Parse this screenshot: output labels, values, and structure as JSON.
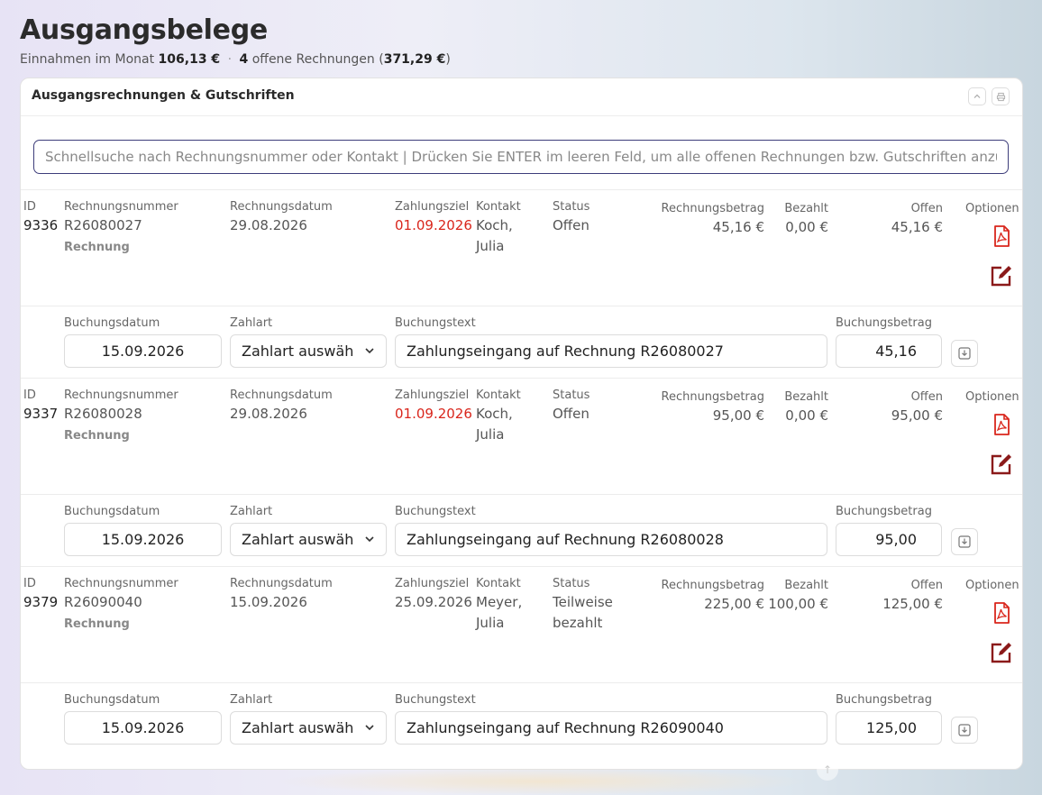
{
  "page": {
    "title": "Ausgangsbelege",
    "summary": {
      "income_label": "Einnahmen im Monat",
      "income_value": "106,13 €",
      "separator": "·",
      "open_count": "4",
      "open_label": "offene Rechnungen",
      "open_paren_open": "(",
      "open_sum": "371,29 €",
      "open_paren_close": ")"
    }
  },
  "card": {
    "title": "Ausgangsrechnungen & Gutschriften",
    "search_placeholder": "Schnellsuche nach Rechnungsnummer oder Kontakt | Drücken Sie ENTER im leeren Feld, um alle offenen Rechnungen bzw. Gutschriften anzuzeigen"
  },
  "labels": {
    "id": "ID",
    "invoice_number": "Rechnungsnummer",
    "invoice_date": "Rechnungsdatum",
    "due": "Zahlungsziel",
    "contact": "Kontakt",
    "status": "Status",
    "amount": "Rechnungsbetrag",
    "paid": "Bezahlt",
    "open": "Offen",
    "options": "Optionen",
    "booking_date": "Buchungsdatum",
    "payment_method": "Zahlart",
    "booking_text": "Buchungstext",
    "booking_amount": "Buchungsbetrag"
  },
  "invoices": [
    {
      "id": "9336",
      "number": "R26080027",
      "type": "Rechnung",
      "date": "29.08.2026",
      "due": "01.09.2026",
      "due_overdue": true,
      "contact_line1": "Koch,",
      "contact_line2": "Julia",
      "status_line1": "Offen",
      "status_line2": "",
      "amount": "45,16 €",
      "paid": "0,00 €",
      "open": "45,16 €",
      "booking": {
        "date": "15.09.2026",
        "method": "Zahlart auswäh",
        "text": "Zahlungseingang auf Rechnung R26080027",
        "amount": "45,16"
      }
    },
    {
      "id": "9337",
      "number": "R26080028",
      "type": "Rechnung",
      "date": "29.08.2026",
      "due": "01.09.2026",
      "due_overdue": true,
      "contact_line1": "Koch,",
      "contact_line2": "Julia",
      "status_line1": "Offen",
      "status_line2": "",
      "amount": "95,00 €",
      "paid": "0,00 €",
      "open": "95,00 €",
      "booking": {
        "date": "15.09.2026",
        "method": "Zahlart auswäh",
        "text": "Zahlungseingang auf Rechnung R26080028",
        "amount": "95,00"
      }
    },
    {
      "id": "9379",
      "number": "R26090040",
      "type": "Rechnung",
      "date": "15.09.2026",
      "due": "25.09.2026",
      "due_overdue": false,
      "contact_line1": "Meyer,",
      "contact_line2": "Julia",
      "status_line1": "Teilweise",
      "status_line2": "bezahlt",
      "amount": "225,00 €",
      "paid": "100,00 €",
      "open": "125,00 €",
      "booking": {
        "date": "15.09.2026",
        "method": "Zahlart auswäh",
        "text": "Zahlungseingang auf Rechnung R26090040",
        "amount": "125,00"
      }
    }
  ],
  "colors": {
    "overdue": "#d9261c",
    "pdf_icon": "#d9261c",
    "edit_icon": "#8b1a1a",
    "search_border": "#3d3d7a"
  },
  "icons": {
    "pdf": "pdf-icon",
    "edit": "edit-icon",
    "save": "save-booking-icon",
    "collapse": "chevron-up-icon",
    "print": "print-icon",
    "dropdown": "chevron-down-icon",
    "scroll_top": "arrow-up-icon"
  }
}
